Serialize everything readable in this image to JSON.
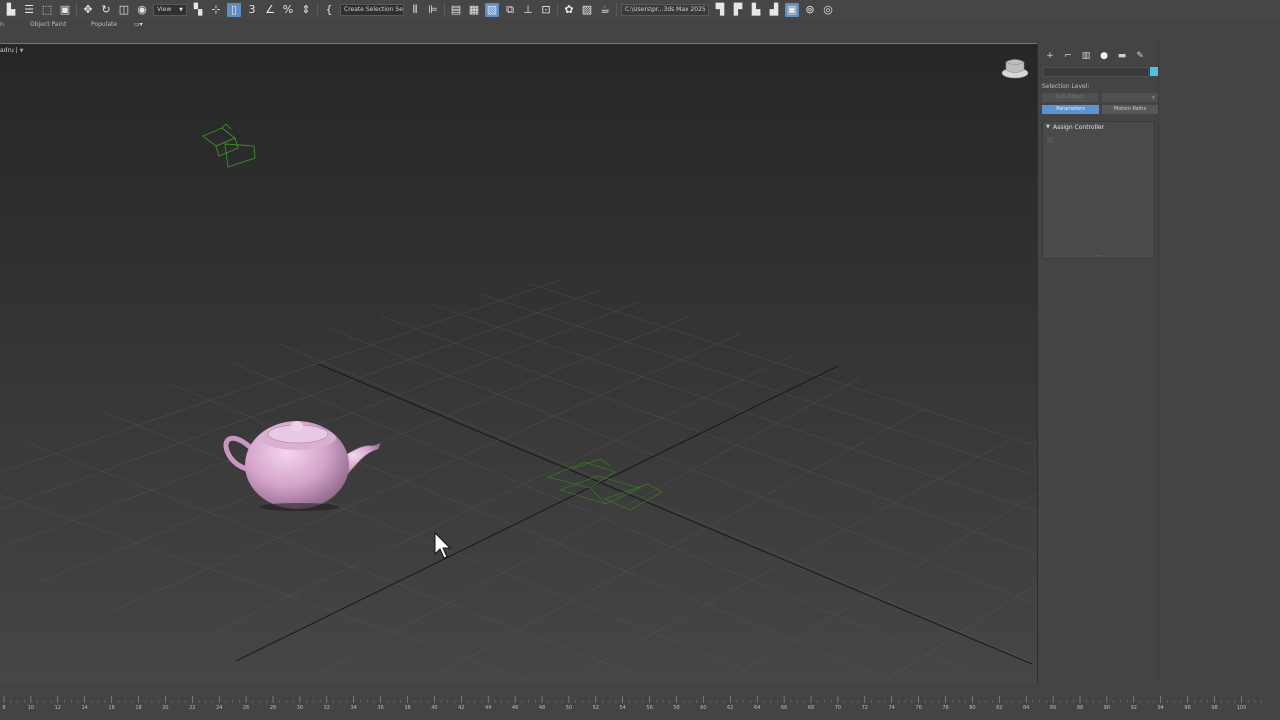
{
  "toolbar": {
    "reference_coord_dropdown": "View",
    "named_selection_dropdown": "Create Selection Set",
    "project_path_dropdown": "C:\\Users\\pr...3ds Max 2025"
  },
  "ribbon": {
    "object_paint": "Object Paint",
    "populate": "Populate"
  },
  "viewport": {
    "label": "adru | ",
    "label_filter": "▼"
  },
  "command_panel": {
    "tabs": [
      {
        "name": "create",
        "glyph": "+"
      },
      {
        "name": "modify",
        "glyph": "⌐"
      },
      {
        "name": "hierarchy",
        "glyph": "▥"
      },
      {
        "name": "motion",
        "glyph": "●"
      },
      {
        "name": "display",
        "glyph": "▬"
      },
      {
        "name": "utilities",
        "glyph": "✎"
      }
    ],
    "object_color": "#4ec3dc",
    "selection_level_label": "Selection Level:",
    "sub_object_button": "Sub-Object",
    "parameters_button": "Parameters",
    "motion_paths_button": "Motion Paths",
    "assign_controller_title": "Assign Controller",
    "rollout_arrow": "▼",
    "rollout_resize": "....",
    "accent_color": "#5b93d3"
  },
  "timeline": {
    "tick_labels": [
      "8",
      "10",
      "12",
      "14",
      "16",
      "18",
      "20",
      "22",
      "24",
      "26",
      "28",
      "30",
      "32",
      "34",
      "36",
      "38",
      "40",
      "42",
      "44",
      "46",
      "48",
      "50",
      "52",
      "54",
      "56",
      "58",
      "60",
      "62",
      "64",
      "66",
      "68",
      "70",
      "72",
      "74",
      "76",
      "78",
      "80",
      "82",
      "84",
      "86",
      "88",
      "90",
      "92",
      "94",
      "96",
      "98",
      "100"
    ]
  }
}
